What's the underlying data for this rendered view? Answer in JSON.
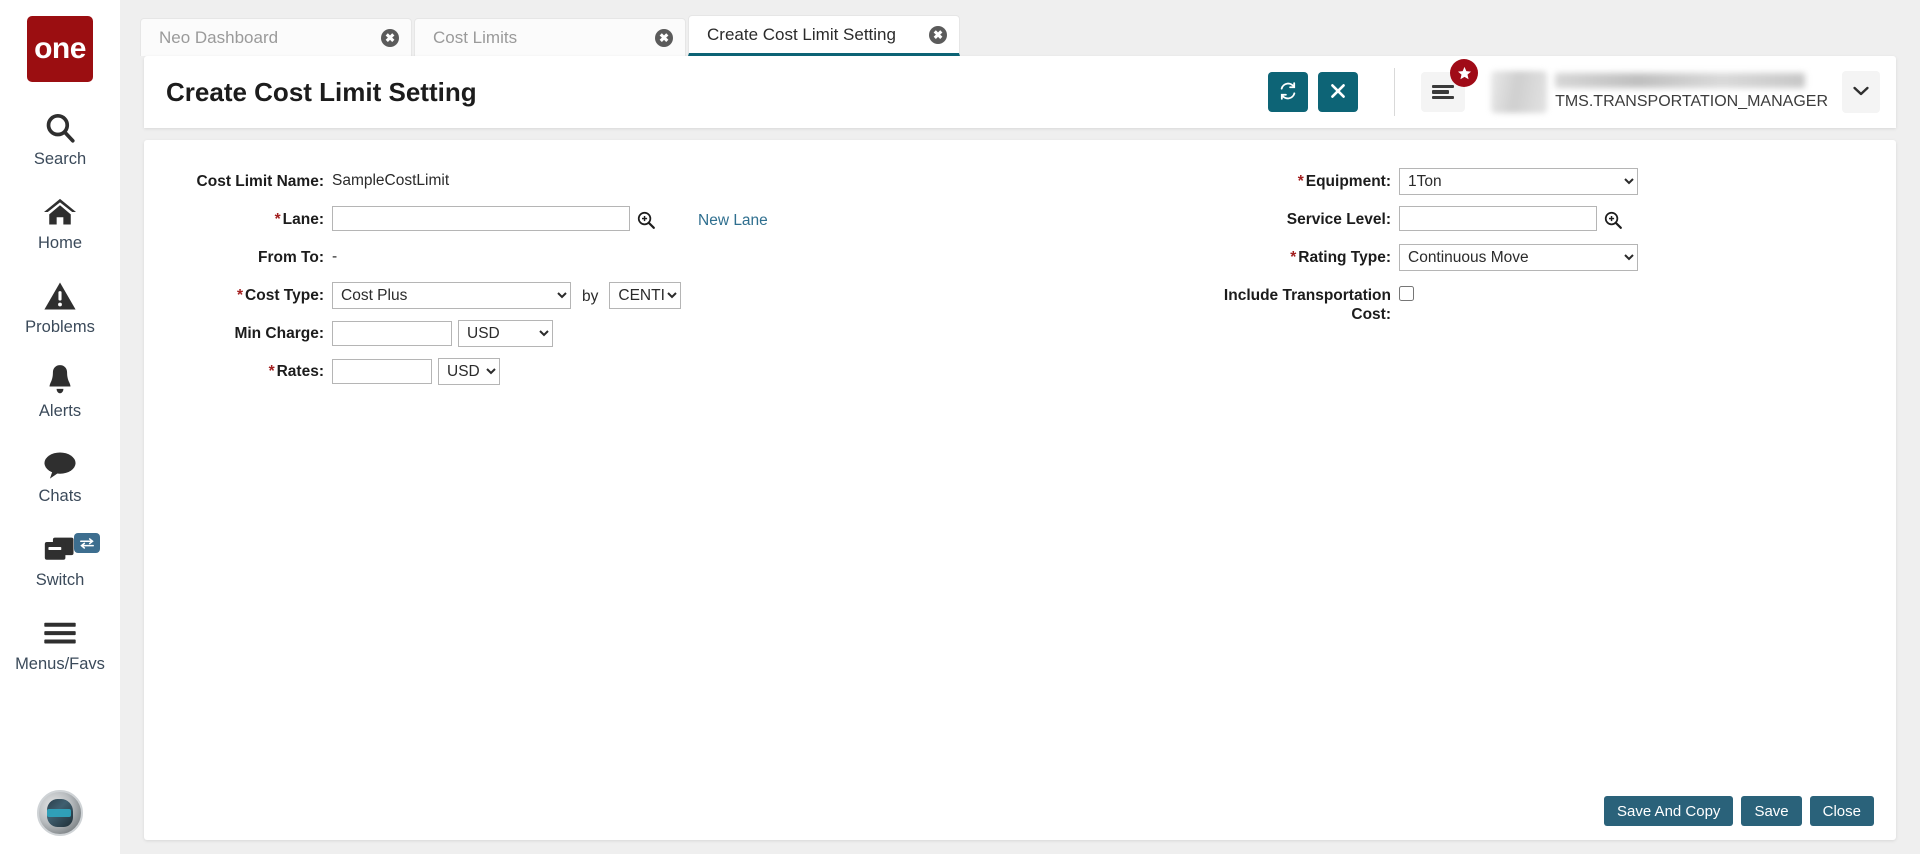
{
  "brand": {
    "logo_text": "one"
  },
  "sidebar": {
    "items": [
      {
        "label": "Search",
        "icon": "search-icon"
      },
      {
        "label": "Home",
        "icon": "home-icon"
      },
      {
        "label": "Problems",
        "icon": "warning-triangle-icon"
      },
      {
        "label": "Alerts",
        "icon": "bell-icon"
      },
      {
        "label": "Chats",
        "icon": "chat-bubble-icon"
      },
      {
        "label": "Switch",
        "icon": "switch-windows-icon",
        "badge_icon": "swap-arrows-icon"
      },
      {
        "label": "Menus/Favs",
        "icon": "hamburger-icon"
      }
    ],
    "assistant_avatar": "robot-assistant-avatar"
  },
  "tabs": [
    {
      "label": "Neo Dashboard",
      "active": false,
      "close_icon": "close-circle-icon"
    },
    {
      "label": "Cost Limits",
      "active": false,
      "close_icon": "close-circle-icon"
    },
    {
      "label": "Create Cost Limit Setting",
      "active": true,
      "close_icon": "close-circle-icon"
    }
  ],
  "header": {
    "title": "Create Cost Limit Setting",
    "refresh_icon": "refresh-icon",
    "close_icon": "close-x-icon",
    "menu_icon": "hamburger-menu-icon",
    "badge_icon": "star-icon",
    "user_role": "TMS.TRANSPORTATION_MANAGER",
    "caret_icon": "chevron-down-icon"
  },
  "form": {
    "left": {
      "cost_limit_name_label": "Cost Limit Name:",
      "cost_limit_name_value": "SampleCostLimit",
      "lane_label": "Lane:",
      "lane_value": "",
      "lane_search_icon": "magnifier-plus-icon",
      "new_lane_link": "New Lane",
      "from_to_label": "From To:",
      "from_to_value": "-",
      "cost_type_label": "Cost Type:",
      "cost_type_value": "Cost Plus",
      "cost_type_options": [
        "Cost Plus"
      ],
      "by_text": "by",
      "unit_value": "CENTIMETER",
      "unit_options": [
        "CENTIMETER"
      ],
      "min_charge_label": "Min Charge:",
      "min_charge_value": "",
      "min_charge_currency": "USD",
      "currency_options": [
        "USD"
      ],
      "rates_label": "Rates:",
      "rates_value": "",
      "rates_currency": "USD"
    },
    "right": {
      "equipment_label": "Equipment:",
      "equipment_value": "1Ton",
      "equipment_options": [
        "1Ton"
      ],
      "service_level_label": "Service Level:",
      "service_level_value": "",
      "service_level_search_icon": "magnifier-plus-icon",
      "rating_type_label": "Rating Type:",
      "rating_type_value": "Continuous Move",
      "rating_type_options": [
        "Continuous Move"
      ],
      "include_transport_label_line1": "Include Transportation",
      "include_transport_label_line2": "Cost:",
      "include_transport_checked": false
    }
  },
  "footer": {
    "save_and_copy": "Save And Copy",
    "save": "Save",
    "close": "Close"
  }
}
